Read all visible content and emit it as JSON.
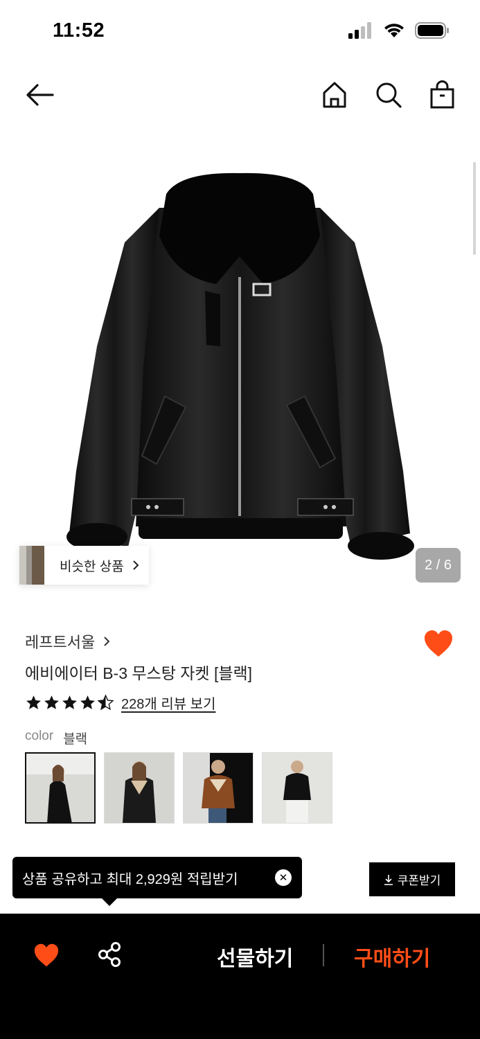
{
  "status_bar": {
    "time": "11:52"
  },
  "nav": {
    "icons": [
      "back-arrow-icon",
      "home-icon",
      "search-icon",
      "shopping-bag-icon"
    ]
  },
  "gallery": {
    "similar_label": "비슷한 상품",
    "page_counter": "2 / 6"
  },
  "product": {
    "brand": "레프트서울",
    "name": "에비에이터 B-3 무스탕 자켓 [블랙]",
    "rating": 4.5,
    "review_link": "228개 리뷰 보기",
    "liked": true
  },
  "color": {
    "label": "color",
    "value": "블랙",
    "selected_index": 0
  },
  "toast": {
    "text": "상품 공유하고 최대 2,929원 적립받기",
    "close": "✕"
  },
  "coupon": {
    "label": "쿠폰받기"
  },
  "bottom_bar": {
    "gift_label": "선물하기",
    "buy_label": "구매하기"
  },
  "colors": {
    "accent": "#ff4d17",
    "heart": "#ff4d17",
    "toast_bg": "#000000"
  }
}
